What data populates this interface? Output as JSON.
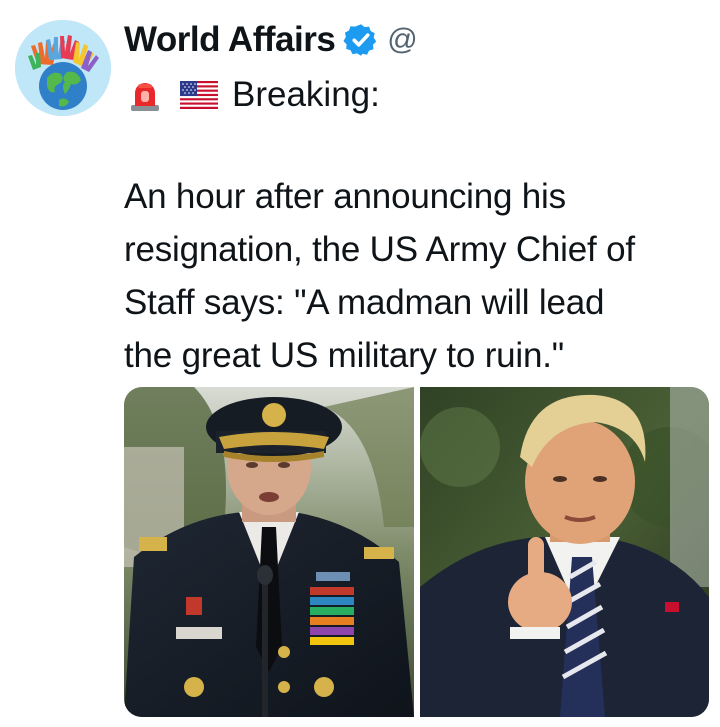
{
  "account": {
    "display_name": "World Affairs",
    "handle": "@",
    "verified": true,
    "avatar_icon": "hands-around-globe-avatar"
  },
  "header": {
    "siren_icon": "rotating-light-emoji",
    "flag_icon": "us-flag-emoji",
    "label": "Breaking:"
  },
  "tweet": {
    "text_lines": [
      "An hour after announcing his",
      "resignation, the US Army Chief of",
      "Staff says: \"A madman will lead",
      "the great US military to ruin.\""
    ]
  },
  "media": {
    "images": [
      {
        "name": "army-general-photo"
      },
      {
        "name": "man-pointing-photo"
      }
    ]
  },
  "colors": {
    "verified_blue": "#1d9bf0",
    "handle_gray": "#536471",
    "text": "#0f1419"
  }
}
